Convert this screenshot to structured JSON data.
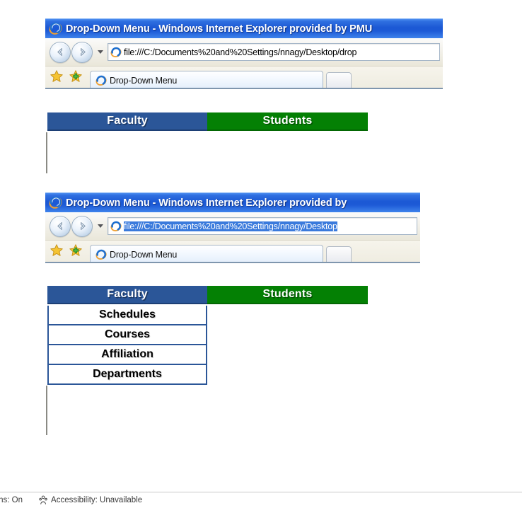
{
  "windows": [
    {
      "id": "window-top",
      "title": "Drop-Down Menu - Windows Internet Explorer provided by PMU",
      "address": "file:///C:/Documents%20and%20Settings/nnagy/Desktop/drop",
      "address_selected": false,
      "tab_label": "Drop-Down Menu",
      "menu": [
        {
          "label": "Faculty",
          "color": "#2b5698"
        },
        {
          "label": "Students",
          "color": "#048004"
        }
      ],
      "dropdown_open": false,
      "dropdown_items": []
    },
    {
      "id": "window-bottom",
      "title": "Drop-Down Menu - Windows Internet Explorer provided by",
      "address": "file:///C:/Documents%20and%20Settings/nnagy/Desktop",
      "address_selected": true,
      "tab_label": "Drop-Down Menu",
      "menu": [
        {
          "label": "Faculty",
          "color": "#2b5698"
        },
        {
          "label": "Students",
          "color": "#048004"
        }
      ],
      "dropdown_open": true,
      "dropdown_items": [
        "Schedules",
        "Courses",
        "Affiliation",
        "Departments"
      ]
    }
  ],
  "statusbar": {
    "options_text": "tions: On",
    "accessibility_text": "Accessibility: Unavailable",
    "accessibility_icon": "accessibility-person-icon"
  },
  "icons": {
    "ie_logo": "internet-explorer-logo-icon",
    "back": "back-arrow-icon",
    "forward": "forward-arrow-icon",
    "history_dropdown": "chevron-down-icon",
    "favorites": "favorites-star-icon",
    "add_favorites": "add-to-favorites-icon",
    "new_tab": "new-tab-button"
  },
  "colors": {
    "titlebar_blue": "#1b58d4",
    "faculty_blue": "#2b5698",
    "students_green": "#048004",
    "selection_blue": "#3a7adc"
  }
}
